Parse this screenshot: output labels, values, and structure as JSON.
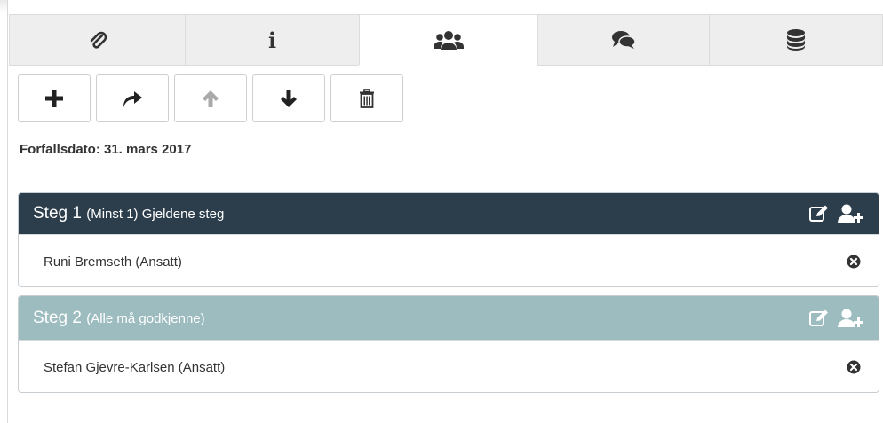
{
  "tabs": [
    {
      "icon": "paperclip-icon",
      "active": false
    },
    {
      "icon": "info-icon",
      "active": false,
      "glyph": "i"
    },
    {
      "icon": "users-icon",
      "active": true
    },
    {
      "icon": "comments-icon",
      "active": false
    },
    {
      "icon": "database-icon",
      "active": false
    }
  ],
  "toolbar": {
    "buttons": [
      {
        "icon": "plus-icon",
        "enabled": true
      },
      {
        "icon": "forward-arrow-icon",
        "enabled": true
      },
      {
        "icon": "arrow-up-icon",
        "enabled": false
      },
      {
        "icon": "arrow-down-icon",
        "enabled": true
      },
      {
        "icon": "trash-icon",
        "enabled": true
      }
    ]
  },
  "due_date": "Forfallsdato: 31. mars 2017",
  "steps": [
    {
      "label": "Steg 1",
      "subtitle": "(Minst 1) Gjeldene steg",
      "header_color": "#2c3e4c",
      "members": [
        {
          "name": "Runi Bremseth (Ansatt)"
        }
      ]
    },
    {
      "label": "Steg 2",
      "subtitle": "(Alle må godkjenne)",
      "header_color": "#9dbcbf",
      "members": [
        {
          "name": "Stefan Gjevre-Karlsen (Ansatt)"
        }
      ]
    }
  ],
  "colors": {
    "tab_bg": "#eeeeee",
    "icon_dark": "#333333",
    "icon_disabled": "#aaaaaa"
  }
}
